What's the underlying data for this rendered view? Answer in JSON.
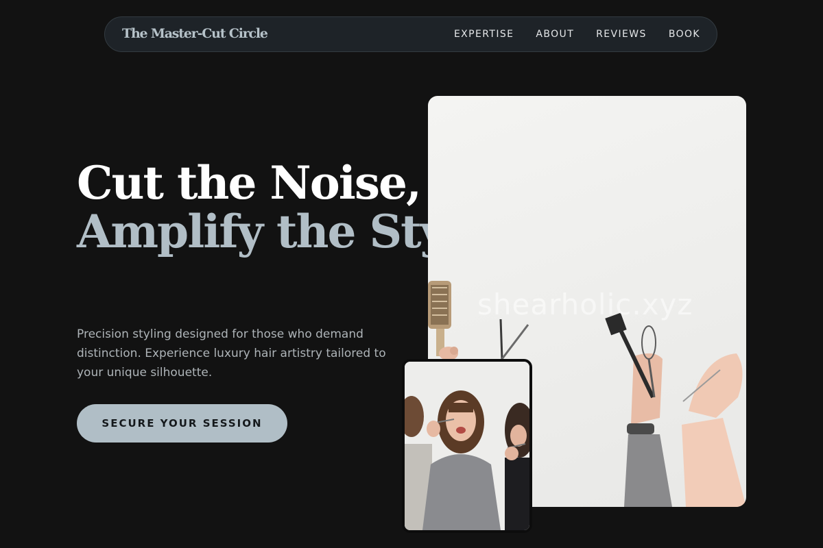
{
  "nav": {
    "brand": "The Master-Cut Circle",
    "links": [
      "EXPERTISE",
      "ABOUT",
      "REVIEWS",
      "BOOK"
    ]
  },
  "hero": {
    "title_line1": "Cut the Noise,",
    "title_line2": "Amplify the Style.",
    "description": "Precision styling designed for those who demand distinction. Experience luxury hair artistry tailored to your unique silhouette.",
    "cta_label": "SECURE YOUR SESSION"
  },
  "images": {
    "main_watermark": "shearholic.xyz",
    "main_subject": "hands holding hair styling tools",
    "small_subject": "group of smiling stylists holding scissors"
  },
  "colors": {
    "background": "#121212",
    "nav_background": "#1e2328",
    "accent": "#b0bec6",
    "title_primary": "#ffffff",
    "title_secondary": "#b1bec6",
    "body_text": "#aeb4b8"
  }
}
